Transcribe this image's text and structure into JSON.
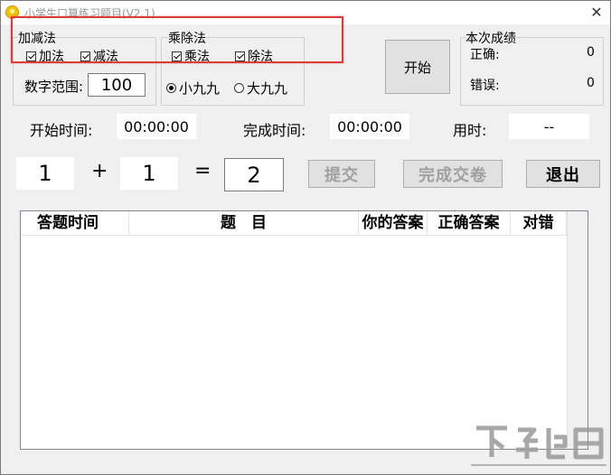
{
  "window": {
    "title": "小学生口算练习题目(V2.1)",
    "close_glyph": "✕"
  },
  "addsub": {
    "title": "加减法",
    "add_label": "加法",
    "sub_label": "减法",
    "add_checked": true,
    "sub_checked": true,
    "range_label": "数字范围:",
    "range_value": "100"
  },
  "muldiv": {
    "title": "乘除法",
    "mul_label": "乘法",
    "div_label": "除法",
    "mul_checked": true,
    "div_checked": true,
    "small_table_label": "小九九",
    "big_table_label": "大九九",
    "selected": "小九九"
  },
  "start_button": "开始",
  "score": {
    "title": "本次成绩",
    "correct_label": "正确:",
    "correct_value": "0",
    "wrong_label": "错误:",
    "wrong_value": "0"
  },
  "times": {
    "start_label": "开始时间:",
    "start_value": "00:00:00",
    "finish_label": "完成时间:",
    "finish_value": "00:00:00",
    "elapsed_label": "用时:",
    "elapsed_value": "--"
  },
  "question": {
    "operand1": "1",
    "operator": "+",
    "operand2": "1",
    "equals": "=",
    "answer": "2"
  },
  "buttons": {
    "submit": "提交",
    "finish": "完成交卷",
    "exit": "退出"
  },
  "table": {
    "columns": [
      "答题时间",
      "题　目",
      "你的答案",
      "正确答案",
      "对错"
    ],
    "rows": []
  },
  "colors": {
    "highlight": "#e03a3a",
    "window_bg": "#f0f0f0"
  },
  "watermark": {
    "icon": "download-site-logo"
  }
}
